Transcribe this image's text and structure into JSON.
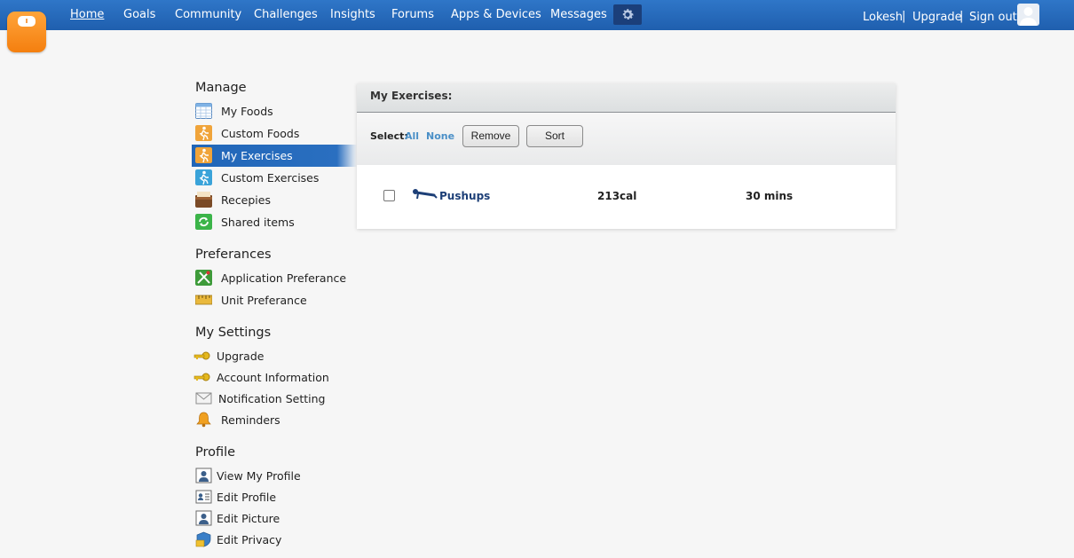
{
  "nav": {
    "items": [
      "Home",
      "Goals",
      "Community",
      "Challenges",
      "Insights",
      "Forums",
      "Apps & Devices",
      "Messages"
    ],
    "settings_icon": "gear-icon"
  },
  "user": {
    "name": "Lokesh",
    "upgrade": "Upgrade",
    "signout": "Sign out",
    "separator": "|"
  },
  "sidebar": {
    "manage": {
      "title": "Manage",
      "items": [
        {
          "label": "My Foods",
          "icon": "calendar-grid-icon"
        },
        {
          "label": "Custom Foods",
          "icon": "runner-icon"
        },
        {
          "label": "My Exercises",
          "icon": "runner-icon"
        },
        {
          "label": "Custom Exercises",
          "icon": "runner-icon"
        },
        {
          "label": "Recepies",
          "icon": "recipe-box-icon"
        },
        {
          "label": "Shared items",
          "icon": "share-icon"
        }
      ]
    },
    "preferences": {
      "title": "Preferances",
      "items": [
        {
          "label": "Application Preferance",
          "icon": "tools-icon"
        },
        {
          "label": "Unit Preferance",
          "icon": "ruler-icon"
        }
      ]
    },
    "settings": {
      "title": "My Settings",
      "items": [
        {
          "label": "Upgrade",
          "icon": "key-icon"
        },
        {
          "label": "Account Information",
          "icon": "key-icon"
        },
        {
          "label": "Notification Setting",
          "icon": "envelope-icon"
        },
        {
          "label": "Reminders",
          "icon": "bell-icon"
        }
      ]
    },
    "profile": {
      "title": "Profile",
      "items": [
        {
          "label": "View My Profile",
          "icon": "profile-card-icon"
        },
        {
          "label": "Edit Profile",
          "icon": "id-card-icon"
        },
        {
          "label": "Edit Picture",
          "icon": "profile-card-icon"
        },
        {
          "label": "Edit Privacy",
          "icon": "shield-icon"
        }
      ]
    }
  },
  "panel": {
    "title": "My Exercises:",
    "select_label": "Select:",
    "select_all": "All",
    "select_none": "None",
    "remove_button": "Remove",
    "sort_button": "Sort"
  },
  "exercises": [
    {
      "name": "Pushups",
      "calories": "213cal",
      "duration": "30 mins",
      "checked": false,
      "icon": "pushup-icon"
    }
  ],
  "colors": {
    "nav_bar": "#2a6cbf",
    "active_item": "#2166b8",
    "link": "#4a8fc7",
    "exercise_link": "#1d3f77",
    "logo": "#f68b1f"
  }
}
